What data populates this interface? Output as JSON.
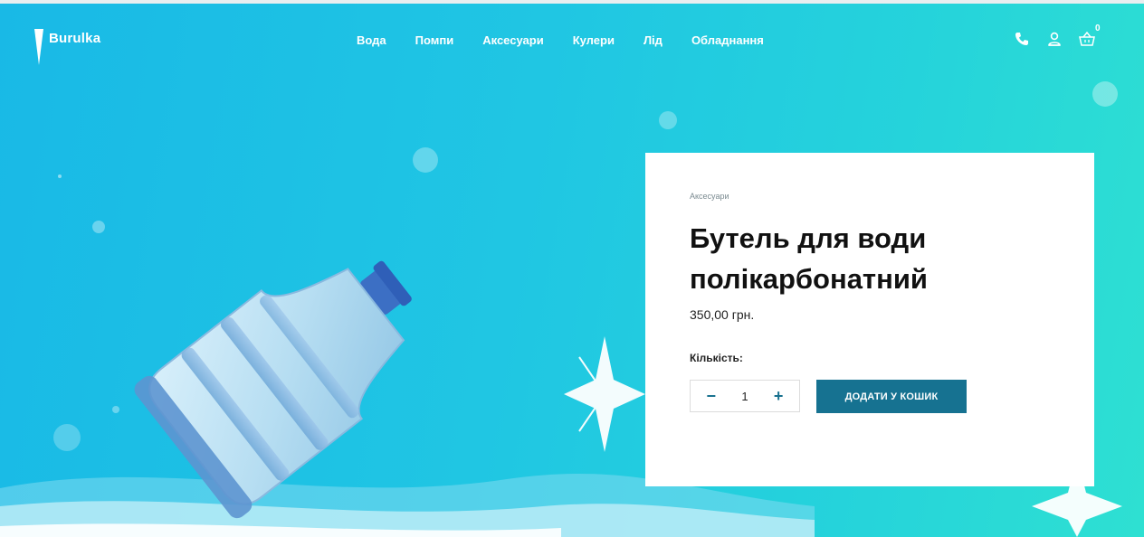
{
  "brand": {
    "name": "Burulka"
  },
  "nav": {
    "items": [
      {
        "label": "Вода"
      },
      {
        "label": "Помпи"
      },
      {
        "label": "Аксесуари"
      },
      {
        "label": "Кулери"
      },
      {
        "label": "Лід"
      },
      {
        "label": "Обладнання"
      }
    ]
  },
  "header": {
    "icons": [
      "phone-icon",
      "user-icon",
      "basket-icon"
    ],
    "cart_count": "0"
  },
  "product": {
    "category": "Аксесуари",
    "title": "Бутель для води полікарбонатний",
    "price": "350,00 грн.",
    "quantity_label": "Кількість:",
    "quantity": "1",
    "minus": "−",
    "plus": "+",
    "add_to_cart": "ДОДАТИ У КОШИК"
  },
  "colors": {
    "accent": "#167291",
    "background_start": "#19b9e6",
    "background_end": "#2ee0d2",
    "card": "#ffffff"
  }
}
